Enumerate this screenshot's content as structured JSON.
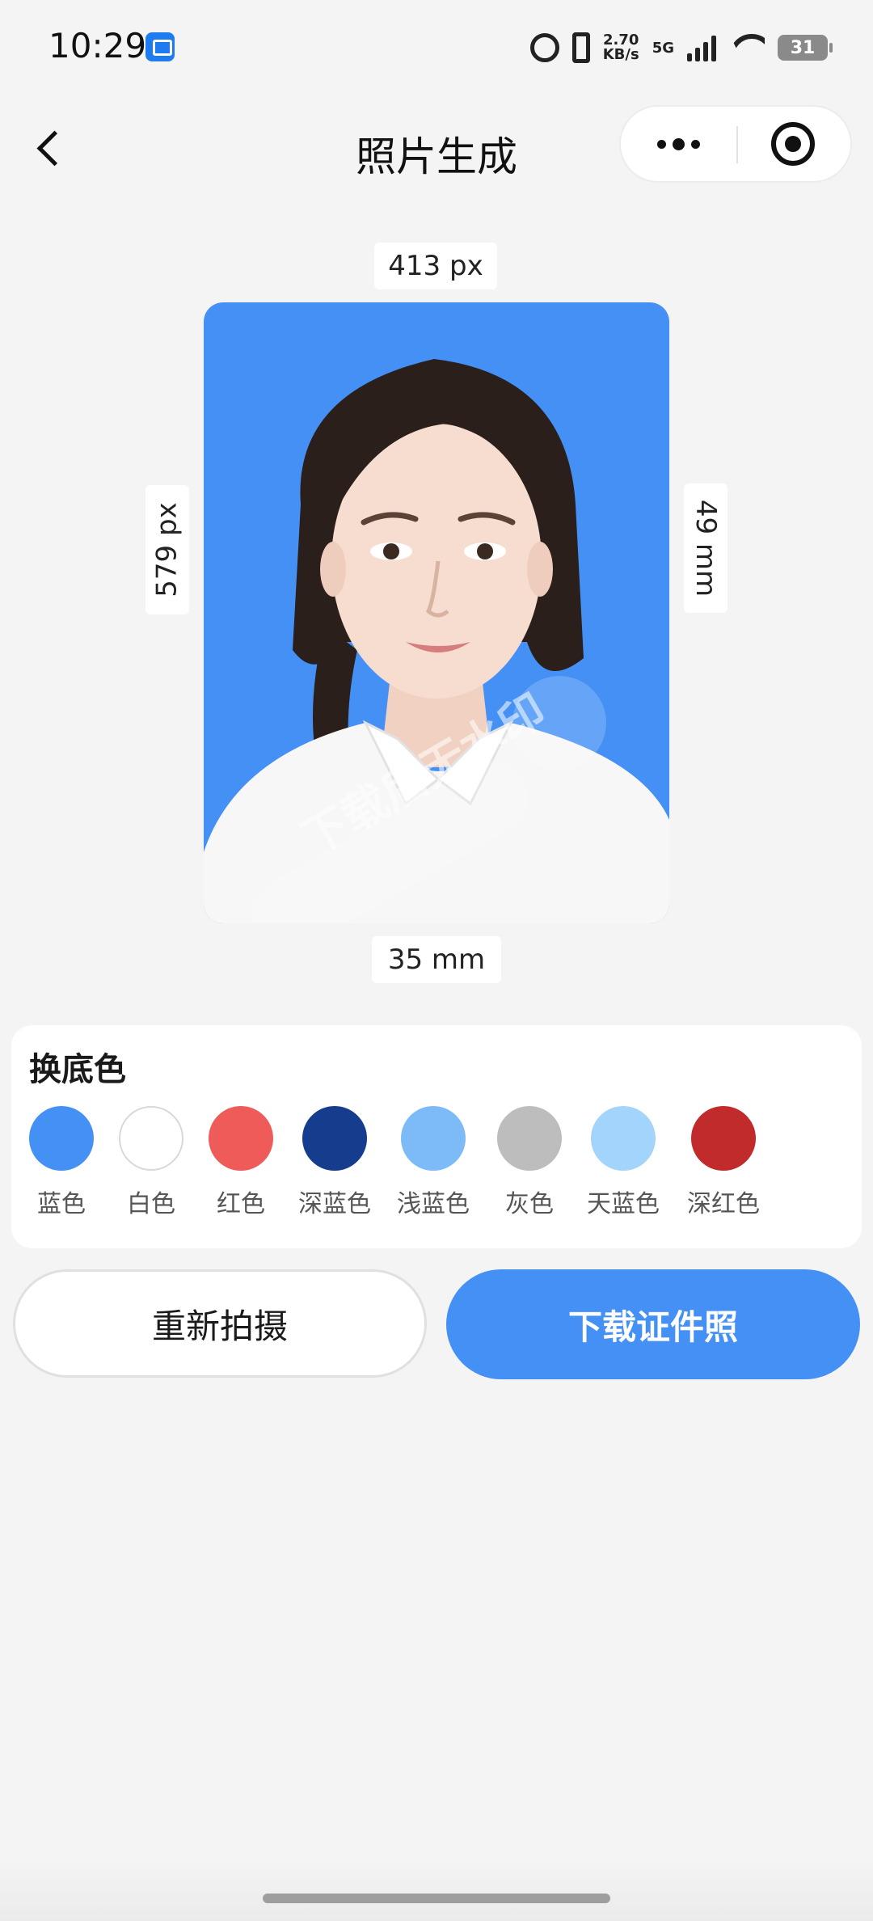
{
  "status_bar": {
    "time": "10:29",
    "network_speed_value": "2.70",
    "network_speed_unit": "KB/s",
    "network_type": "5G",
    "battery": "31",
    "icons": [
      "app-icon",
      "alarm-icon",
      "vibrate-icon",
      "nfc-icon",
      "signal-icon",
      "wifi-icon",
      "battery-icon"
    ]
  },
  "nav": {
    "title": "照片生成",
    "back_icon": "chevron-left-icon",
    "more_icon": "more-dots-icon",
    "close_icon": "target-icon"
  },
  "photo": {
    "width_px": "413 px",
    "height_px": "579 px",
    "height_mm": "49 mm",
    "width_mm": "35 mm",
    "background_color": "#4490f5",
    "watermark": "下载后无水印"
  },
  "color_panel": {
    "title": "换底色",
    "options": [
      {
        "label": "蓝色",
        "color": "#4490f5"
      },
      {
        "label": "白色",
        "color": "#ffffff"
      },
      {
        "label": "红色",
        "color": "#ee5b58"
      },
      {
        "label": "深蓝色",
        "color": "#163c8e"
      },
      {
        "label": "浅蓝色",
        "color": "#7dbaf8"
      },
      {
        "label": "灰色",
        "color": "#bdbdbd"
      },
      {
        "label": "天蓝色",
        "color": "#a3d4fb"
      },
      {
        "label": "深红色",
        "color": "#c12b2b"
      }
    ]
  },
  "actions": {
    "retake_label": "重新拍摄",
    "download_label": "下载证件照"
  },
  "colors": {
    "accent": "#4490f5",
    "page_bg": "#f4f4f5"
  }
}
